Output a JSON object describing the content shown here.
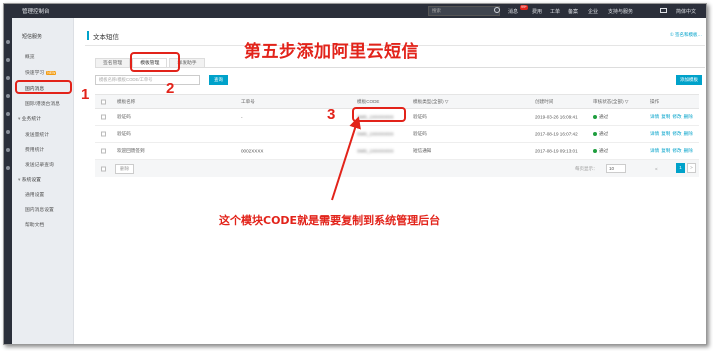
{
  "topbar": {
    "console_label": "管理控制台",
    "search_placeholder": "搜索",
    "nav": [
      "消息",
      "费用",
      "工单",
      "备案",
      "企业",
      "支持与服务",
      "简体中文"
    ],
    "message_badge": "99+"
  },
  "sidebar": {
    "title": "短信服务",
    "items": [
      {
        "label": "概览"
      },
      {
        "label": "快速学习",
        "badge": "NEW"
      },
      {
        "label": "国内消息"
      },
      {
        "label": "国际/港澳台消息"
      }
    ],
    "groups": [
      {
        "label": "业务统计",
        "items": [
          "发送量统计",
          "费用统计",
          "发送记录查询"
        ]
      },
      {
        "label": "系统设置",
        "items": [
          "通用设置",
          "国内消息设置"
        ]
      }
    ],
    "help": "帮助文档"
  },
  "main": {
    "page_title": "文本短信",
    "help_link": "① 签名和模板…",
    "tabs": [
      "签名管理",
      "模板管理",
      "群发助手"
    ],
    "search_placeholder": "模板名称/模板CODE/工单号",
    "query_button": "查询",
    "add_button": "添加模板"
  },
  "table": {
    "headers": [
      "模板名称",
      "工单号",
      "模板CODE",
      "模板类型(全部) ▽",
      "创建时间",
      "审核状态(全部) ▽",
      "操作"
    ],
    "rows": [
      {
        "name": "验证码",
        "ticket": "-",
        "code": "SMS_1XXXXXXX",
        "type": "验证码",
        "created": "2019-03-26 16:09:41",
        "status": "通过"
      },
      {
        "name": "验证码",
        "ticket": "",
        "code": "SMS_1XXXXXXX",
        "type": "验证码",
        "created": "2017-08-19 16:07:42",
        "status": "通过"
      },
      {
        "name": "欢迎回馈签到",
        "ticket": "0002XXXX",
        "code": "SMS_1XXXXXXX",
        "type": "短信通知",
        "created": "2017-08-19 09:13:01",
        "status": "通过"
      }
    ],
    "ops": [
      "详情",
      "复制",
      "修改",
      "删除"
    ],
    "footer": {
      "delete_label": "删除",
      "per_page_label": "每页显示：",
      "per_page": "10",
      "prev": "<",
      "next": ">",
      "current_page": "1"
    }
  },
  "annotations": {
    "step_title": "第五步添加阿里云短信",
    "num1": "1",
    "num2": "2",
    "num3": "3",
    "note": "这个模块CODE就是需要复制到系统管理后台"
  },
  "colors": {
    "accent": "#00a2ca",
    "annotation_red": "#e2231a",
    "status_green": "#1e9e3e",
    "topbar": "#2b2f3a"
  }
}
